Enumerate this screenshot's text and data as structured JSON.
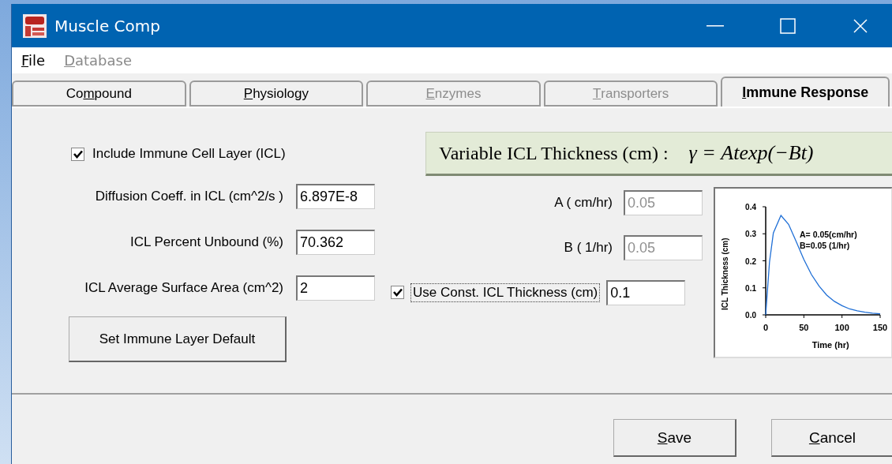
{
  "window": {
    "title": "Muscle Comp"
  },
  "menu": [
    {
      "label": {
        "mnemonic": "F",
        "rest": "ile"
      },
      "disabled": false
    },
    {
      "label": {
        "mnemonic": "D",
        "rest": "atabase"
      },
      "disabled": true
    }
  ],
  "tabs": [
    {
      "label": {
        "lead": "Co",
        "mnemonic": "m",
        "rest": "pound"
      },
      "selected": false,
      "disabled": false
    },
    {
      "label": {
        "mnemonic": "P",
        "rest": "hysiology"
      },
      "selected": false,
      "disabled": false
    },
    {
      "label": {
        "mnemonic": "E",
        "rest": "nzymes"
      },
      "selected": false,
      "disabled": true
    },
    {
      "label": {
        "mnemonic": "T",
        "rest": "ransporters"
      },
      "selected": false,
      "disabled": true
    },
    {
      "label": {
        "mnemonic": "I",
        "rest": "mmune Response"
      },
      "selected": true,
      "disabled": false
    }
  ],
  "include_icl": {
    "label": "Include Immune Cell Layer (ICL)",
    "checked": true
  },
  "fields": [
    {
      "label": "Diffusion Coeff. in ICL (cm^2/s )",
      "value": "6.897E-8"
    },
    {
      "label": "ICL Percent Unbound (%)",
      "value": "70.362"
    },
    {
      "label": "ICL Average Surface Area (cm^2)",
      "value": "2"
    }
  ],
  "default_button": "Set Immune Layer Default",
  "formula": {
    "caption": "Variable ICL Thickness (cm) :",
    "equation": "γ = Atexp(−Bt)"
  },
  "params": [
    {
      "label": "A ( cm/hr)",
      "value": "0.05",
      "disabled": true
    },
    {
      "label": "B ( 1/hr)",
      "value": "0.05",
      "disabled": true
    }
  ],
  "const_thickness": {
    "label": "Use Const. ICL Thickness (cm)",
    "checked": true,
    "value": "0.1"
  },
  "chart": {
    "chart_data": {
      "type": "line",
      "xlabel": "Time (hr)",
      "ylabel": "ICL Thickness (cm)",
      "x": [
        0,
        5,
        10,
        20,
        30,
        40,
        50,
        60,
        70,
        80,
        90,
        100,
        110,
        120,
        130,
        140,
        150
      ],
      "series": [
        {
          "color": "#1f6fd6",
          "values": [
            0,
            0.195,
            0.303,
            0.368,
            0.335,
            0.271,
            0.205,
            0.149,
            0.106,
            0.073,
            0.05,
            0.034,
            0.022,
            0.015,
            0.01,
            0.006,
            0.004
          ]
        }
      ],
      "xlim": [
        0,
        150
      ],
      "ylim": [
        0,
        0.4
      ],
      "xticks": [
        0,
        50,
        100,
        150
      ],
      "yticks": [
        {
          "value": 0,
          "label": "0.0"
        },
        {
          "value": 0.1,
          "label": "0.1"
        },
        {
          "value": 0.2,
          "label": "0.2"
        },
        {
          "value": 0.3,
          "label": "0.3"
        },
        {
          "value": 0.4,
          "label": "0.4"
        }
      ],
      "annotations": [
        "A= 0.05(cm/hr)",
        "B=0.05 (1/hr)"
      ]
    }
  },
  "buttons": [
    {
      "label": {
        "mnemonic": "S",
        "rest": "ave"
      }
    },
    {
      "label": {
        "mnemonic": "C",
        "rest": "ancel"
      }
    }
  ]
}
